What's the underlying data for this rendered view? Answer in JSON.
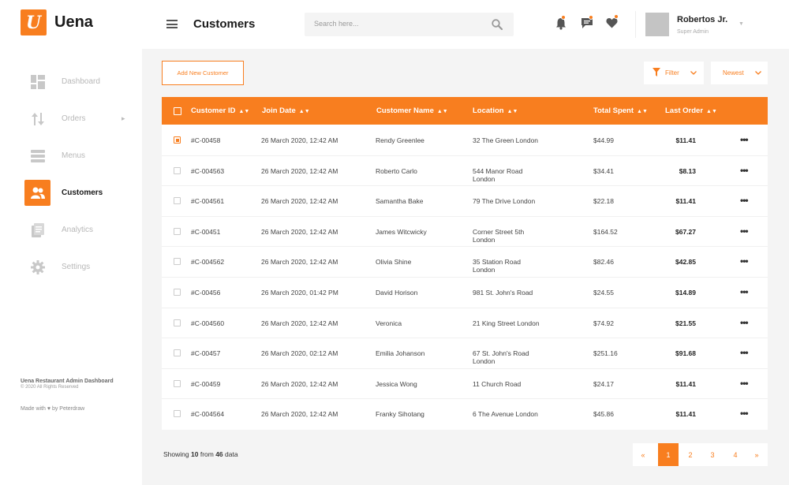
{
  "brand": {
    "logo_letter": "U",
    "name": "Uena"
  },
  "sidebar": {
    "items": [
      {
        "label": "Dashboard",
        "icon": "dashboard-icon",
        "active": false
      },
      {
        "label": "Orders",
        "icon": "orders-icon",
        "active": false,
        "has_submenu": true
      },
      {
        "label": "Menus",
        "icon": "menus-icon",
        "active": false
      },
      {
        "label": "Customers",
        "icon": "customers-icon",
        "active": true
      },
      {
        "label": "Analytics",
        "icon": "analytics-icon",
        "active": false
      },
      {
        "label": "Settings",
        "icon": "gear-icon",
        "active": false
      }
    ],
    "footer": {
      "title": "Uena Restaurant Admin Dashboard",
      "copyright": "© 2020 All Rights Reserved",
      "credit": "Made with ♥ by Peterdraw"
    }
  },
  "header": {
    "title": "Customers",
    "search_placeholder": "Search here...",
    "user": {
      "name": "Robertos Jr.",
      "role": "Super Admin"
    }
  },
  "toolbar": {
    "add_label": "Add New Customer",
    "filter_label": "Filter",
    "sort_label": "Newest"
  },
  "table": {
    "columns": [
      "Customer ID",
      "Join Date",
      "Customer Name",
      "Location",
      "Total Spent",
      "Last Order"
    ],
    "rows": [
      {
        "checked": true,
        "id": "#C-00458",
        "date": "26 March 2020, 12:42 AM",
        "name": "Rendy Greenlee",
        "location": "32 The Green London",
        "spent": "$44.99",
        "last": "$11.41"
      },
      {
        "checked": false,
        "id": "#C-004563",
        "date": "26 March 2020, 12:42 AM",
        "name": "Roberto Carlo",
        "location": "544 Manor Road London",
        "spent": "$34.41",
        "last": "$8.13"
      },
      {
        "checked": false,
        "id": "#C-004561",
        "date": "26 March 2020, 12:42 AM",
        "name": "Samantha Bake",
        "location": "79 The Drive London",
        "spent": "$22.18",
        "last": "$11.41"
      },
      {
        "checked": false,
        "id": "#C-00451",
        "date": "26 March 2020, 12:42 AM",
        "name": "James Witcwicky",
        "location": "Corner Street 5th London",
        "spent": "$164.52",
        "last": "$67.27"
      },
      {
        "checked": false,
        "id": "#C-004562",
        "date": "26 March 2020, 12:42 AM",
        "name": "Olivia Shine",
        "location": "35 Station Road London",
        "spent": "$82.46",
        "last": "$42.85"
      },
      {
        "checked": false,
        "id": "#C-00456",
        "date": "26 March 2020, 01:42 PM",
        "name": "David Horison",
        "location": "981 St. John's Road",
        "spent": "$24.55",
        "last": "$14.89"
      },
      {
        "checked": false,
        "id": "#C-004560",
        "date": "26 March 2020, 12:42 AM",
        "name": "Veronica",
        "location": "21 King Street London",
        "spent": "$74.92",
        "last": "$21.55"
      },
      {
        "checked": false,
        "id": "#C-00457",
        "date": "26 March 2020, 02:12 AM",
        "name": "Emilia Johanson",
        "location": "67 St. John's Road London",
        "spent": "$251.16",
        "last": "$91.68"
      },
      {
        "checked": false,
        "id": "#C-00459",
        "date": "26 March 2020, 12:42 AM",
        "name": "Jessica Wong",
        "location": "11 Church Road",
        "spent": "$24.17",
        "last": "$11.41"
      },
      {
        "checked": false,
        "id": "#C-004564",
        "date": "26 March 2020, 12:42 AM",
        "name": "Franky Sihotang",
        "location": "6 The Avenue London",
        "spent": "$45.86",
        "last": "$11.41"
      }
    ]
  },
  "footer": {
    "showing_prefix": "Showing",
    "showing_count": "10",
    "showing_mid": "from",
    "showing_total": "46",
    "showing_suffix": "data",
    "pages": [
      "1",
      "2",
      "3",
      "4"
    ],
    "active_page": "1",
    "prev": "«",
    "next": "»"
  },
  "colors": {
    "accent": "#f87e1f",
    "background": "#f4f4f4"
  }
}
